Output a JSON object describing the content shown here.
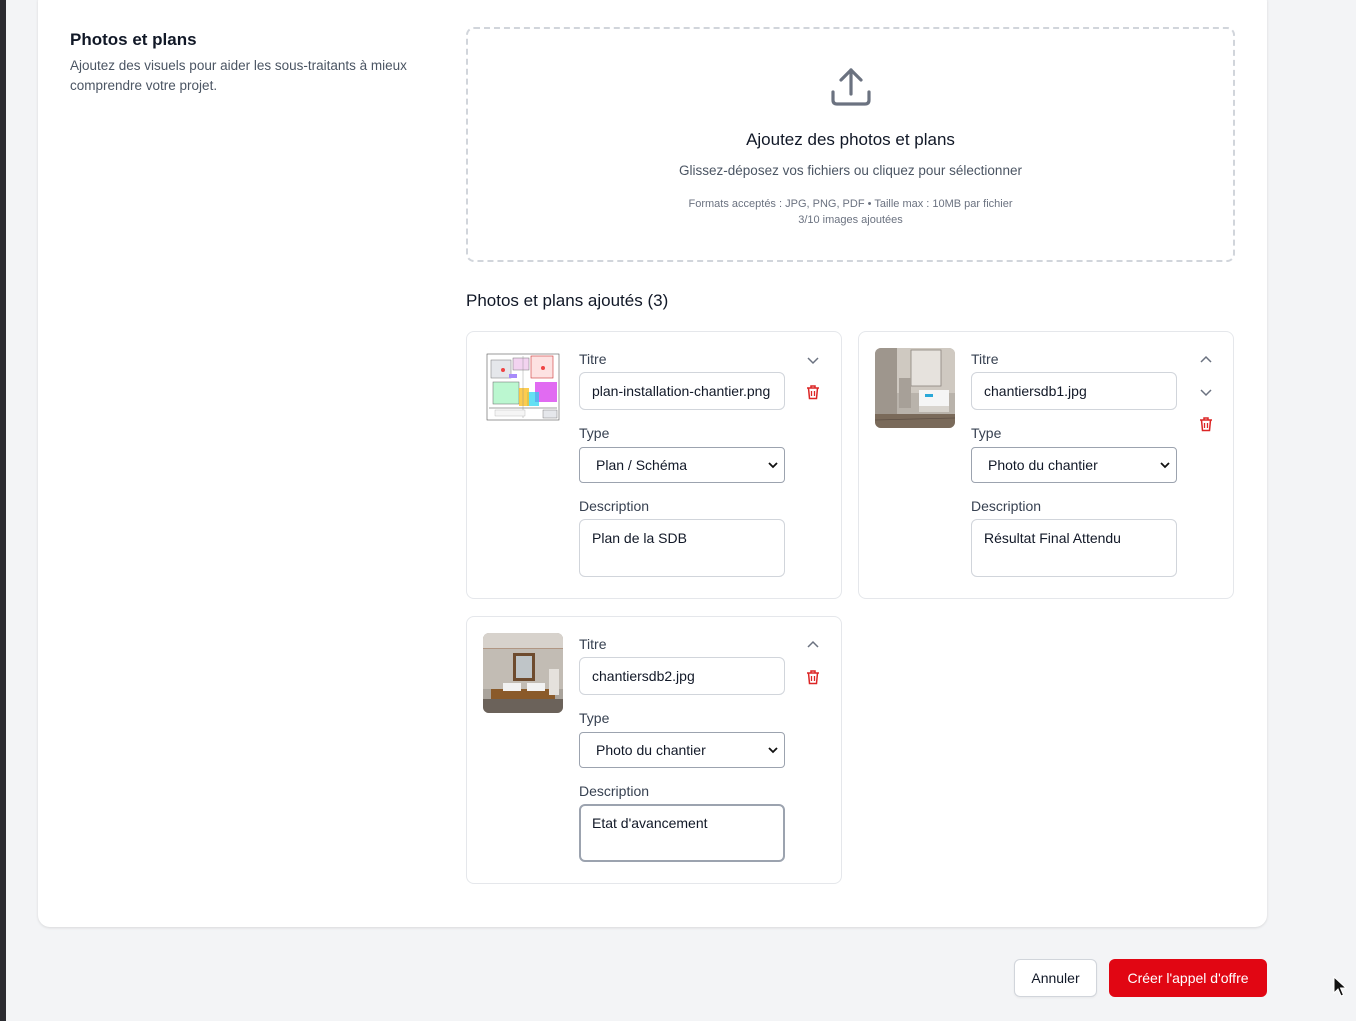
{
  "section": {
    "title": "Photos et plans",
    "description": "Ajoutez des visuels pour aider les sous-traitants à mieux comprendre votre projet."
  },
  "dropzone": {
    "icon": "upload-icon",
    "title": "Ajoutez des photos et plans",
    "subtitle": "Glissez-déposez vos fichiers ou cliquez pour sélectionner",
    "formats": "Formats acceptés : JPG, PNG, PDF • Taille max : 10MB par fichier",
    "count": "3/10 images ajoutées"
  },
  "added": {
    "title": "Photos et plans ajoutés (3)"
  },
  "items": [
    {
      "title_label": "Titre",
      "title_value": "plan-installation-chantier.png",
      "type_label": "Type",
      "type_value": "Plan / Schéma",
      "description_label": "Description",
      "description_value": "Plan de la SDB",
      "thumbnail": "plan-thumbnail"
    },
    {
      "title_label": "Titre",
      "title_value": "chantiersdb1.jpg",
      "type_label": "Type",
      "type_value": "Photo du chantier",
      "description_label": "Description",
      "description_value": "Résultat Final Attendu",
      "thumbnail": "bathroom-photo-thumbnail"
    },
    {
      "title_label": "Titre",
      "title_value": "chantiersdb2.jpg",
      "type_label": "Type",
      "type_value": "Photo du chantier",
      "description_label": "Description",
      "description_value": "Etat d'avancement",
      "thumbnail": "bathroom-photo-thumbnail"
    }
  ],
  "actions": {
    "cancel": "Annuler",
    "create": "Créer l'appel d'offre"
  },
  "colors": {
    "primary": "#e10613",
    "delete_icon": "#dc2626",
    "page_bg": "#f3f4f6",
    "card_bg": "#ffffff"
  }
}
